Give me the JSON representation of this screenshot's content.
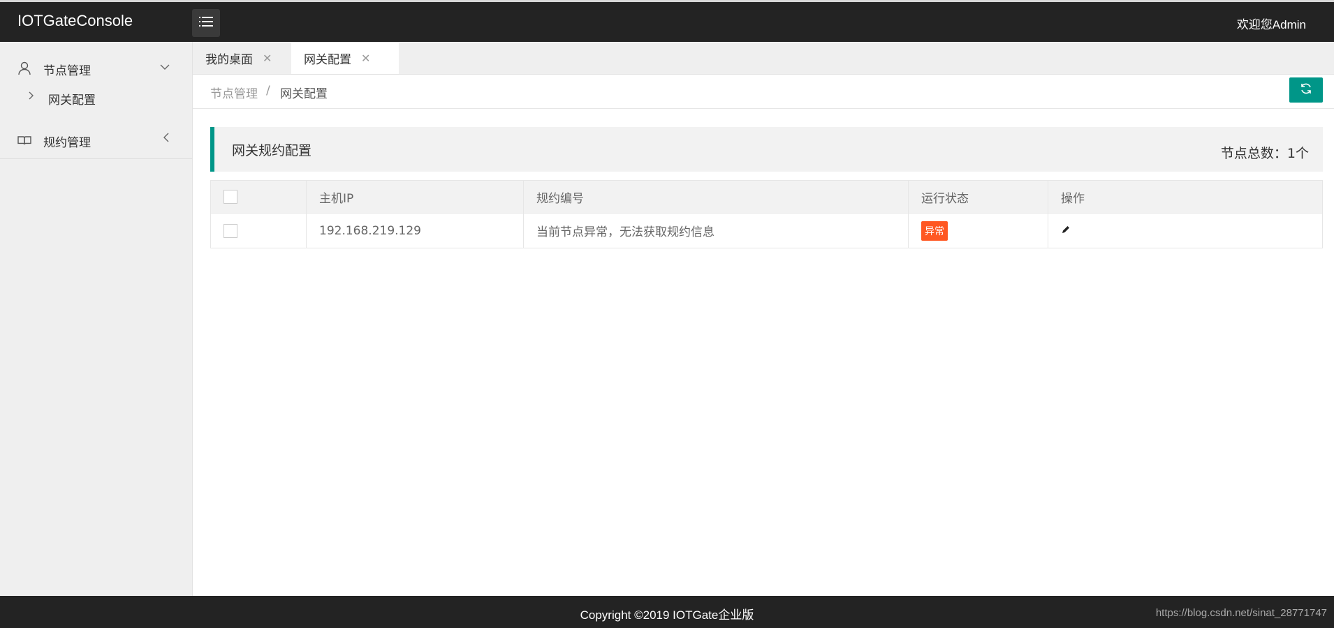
{
  "header": {
    "app_title": "IOTGateConsole",
    "welcome": "欢迎您Admin"
  },
  "sidebar": {
    "items": [
      {
        "label": "节点管理",
        "icon": "user-icon",
        "expanded": true,
        "children": [
          {
            "label": "网关配置"
          }
        ]
      },
      {
        "label": "规约管理",
        "icon": "book-icon",
        "expanded": false
      }
    ]
  },
  "tabs": [
    {
      "label": "我的桌面",
      "active": false
    },
    {
      "label": "网关配置",
      "active": true
    }
  ],
  "breadcrumb": {
    "parent": "节点管理",
    "separator": "/",
    "current": "网关配置"
  },
  "panel": {
    "title": "网关规约配置",
    "count_text": "节点总数：1个"
  },
  "table": {
    "columns": [
      "主机IP",
      "规约编号",
      "运行状态",
      "操作"
    ],
    "rows": [
      {
        "ip": "192.168.219.129",
        "protocol": "当前节点异常，无法获取规约信息",
        "status": "异常",
        "action_icon": "edit-icon"
      }
    ]
  },
  "colors": {
    "accent": "#009688",
    "topbar": "#232323",
    "status_error": "#ff5722"
  },
  "footer": {
    "copyright": "Copyright ©2019 IOTGate企业版",
    "watermark": "https://blog.csdn.net/sinat_28771747"
  }
}
